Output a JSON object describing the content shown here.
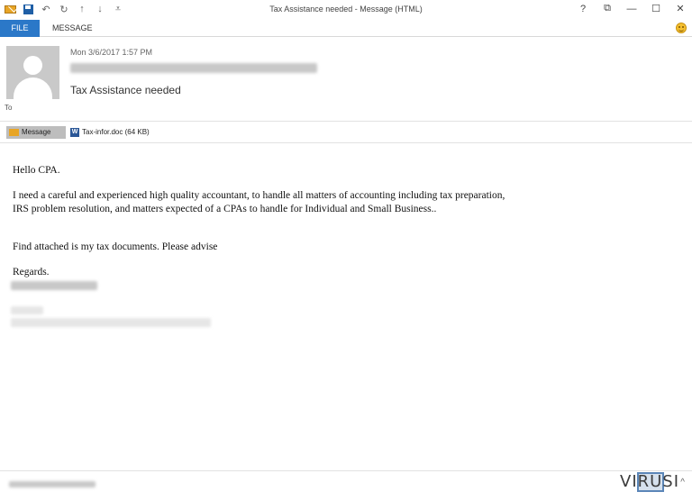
{
  "window": {
    "title": "Tax Assistance needed - Message (HTML)",
    "controls": [
      "?",
      "⧉",
      "—",
      "☐",
      "✕"
    ]
  },
  "quick_access": {
    "icons": [
      "envelope-icon",
      "save-icon",
      "undo-icon",
      "redo-icon",
      "up-arrow-icon",
      "down-arrow-icon",
      "customize-icon"
    ]
  },
  "ribbon": {
    "tabs": [
      {
        "label": "FILE",
        "active": true
      },
      {
        "label": "MESSAGE",
        "active": false
      }
    ]
  },
  "header": {
    "date": "Mon 3/6/2017 1:57 PM",
    "subject": "Tax Assistance needed",
    "to_label": "To"
  },
  "attachments": {
    "message_label": "Message",
    "file_label": "Tax-infor.doc (64 KB)"
  },
  "body": {
    "greeting": "Hello CPA.",
    "line1": "I need a careful and experienced high quality accountant, to handle all matters of accounting including tax preparation,",
    "line2": "IRS problem resolution, and matters expected of a CPAs to handle for Individual and Small Business..",
    "line3": "Find attached is my tax documents. Please advise",
    "closing": "Regards."
  },
  "watermark": {
    "text": "VIRUSI"
  },
  "colors": {
    "accent": "#2b78c8",
    "avatar_bg": "#c9c9c9"
  }
}
